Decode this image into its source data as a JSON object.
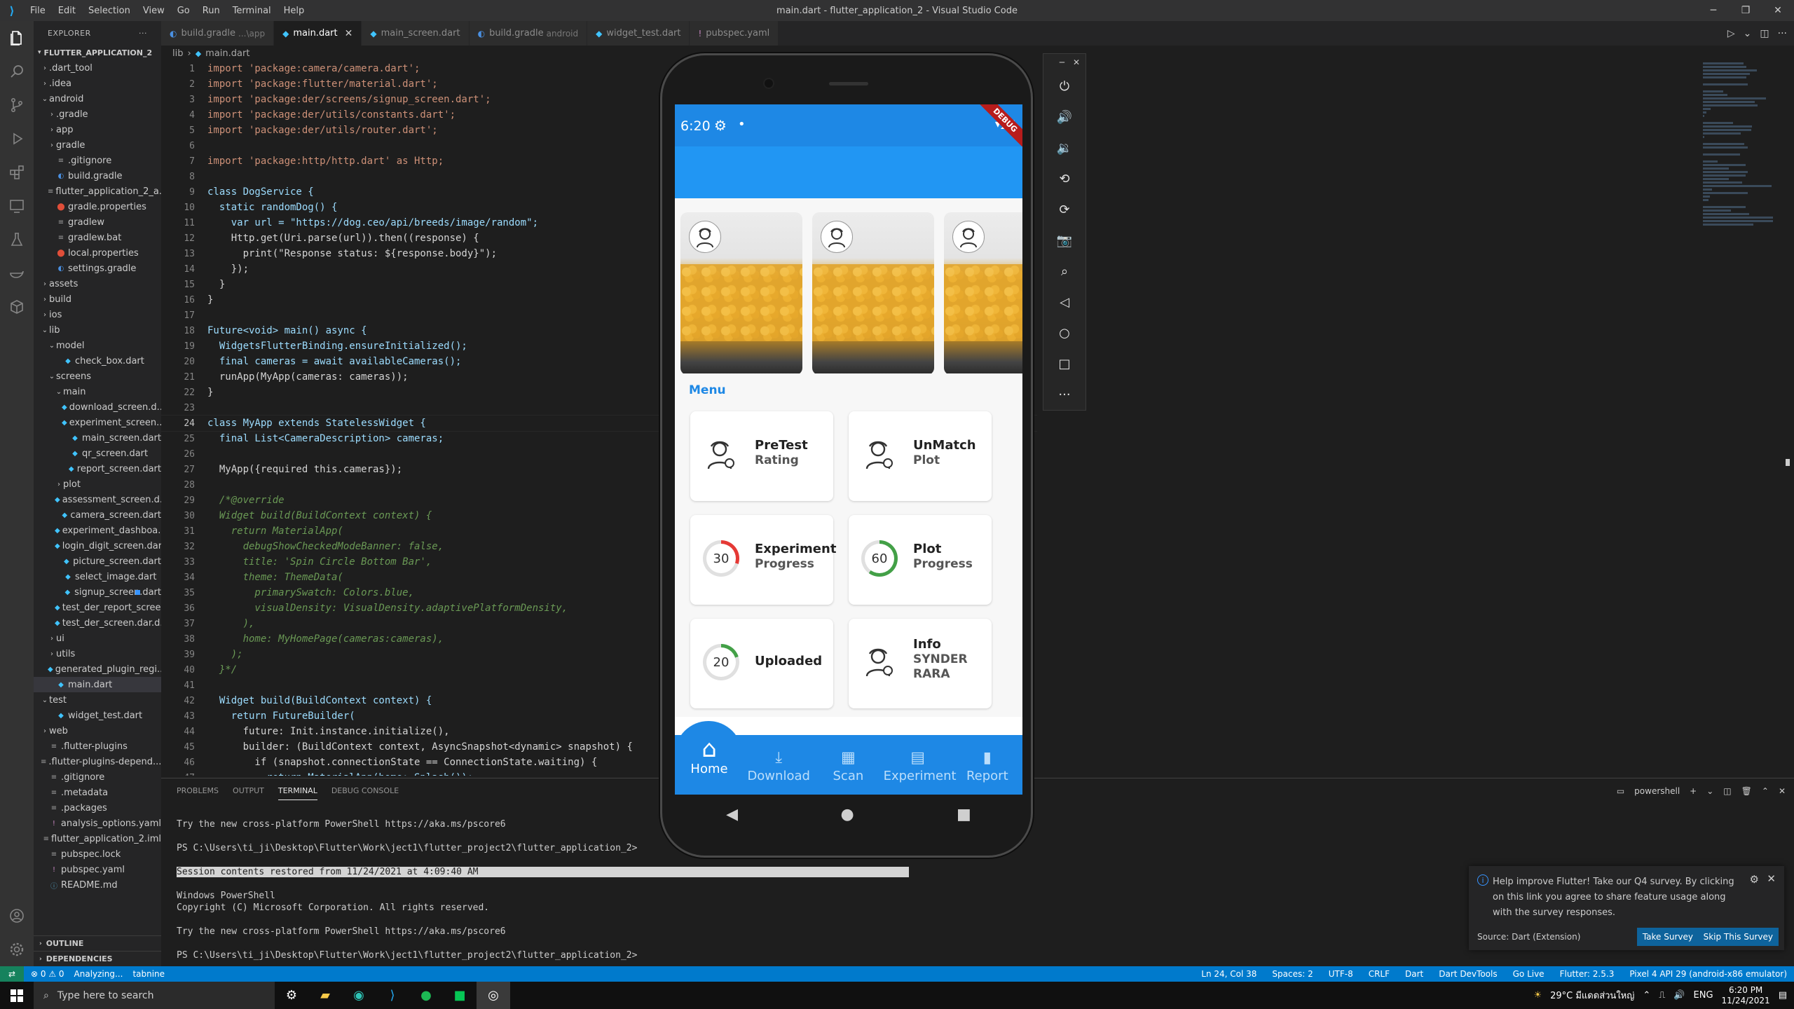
{
  "window_title": "main.dart - flutter_application_2 - Visual Studio Code",
  "menu": [
    "File",
    "Edit",
    "Selection",
    "View",
    "Go",
    "Run",
    "Terminal",
    "Help"
  ],
  "explorer": {
    "title": "EXPLORER",
    "project": "FLUTTER_APPLICATION_2",
    "items": [
      {
        "label": ".dart_tool",
        "depth": 1,
        "type": "folder",
        "open": false
      },
      {
        "label": ".idea",
        "depth": 1,
        "type": "folder",
        "open": false
      },
      {
        "label": "android",
        "depth": 1,
        "type": "folder",
        "open": true
      },
      {
        "label": ".gradle",
        "depth": 2,
        "type": "folder",
        "open": false
      },
      {
        "label": "app",
        "depth": 2,
        "type": "folder",
        "open": false
      },
      {
        "label": "gradle",
        "depth": 2,
        "type": "folder",
        "open": false
      },
      {
        "label": ".gitignore",
        "depth": 2,
        "type": "file"
      },
      {
        "label": "build.gradle",
        "depth": 2,
        "type": "gradle"
      },
      {
        "label": "flutter_application_2_a...",
        "depth": 2,
        "type": "file"
      },
      {
        "label": "gradle.properties",
        "depth": 2,
        "type": "props"
      },
      {
        "label": "gradlew",
        "depth": 2,
        "type": "file"
      },
      {
        "label": "gradlew.bat",
        "depth": 2,
        "type": "file"
      },
      {
        "label": "local.properties",
        "depth": 2,
        "type": "props"
      },
      {
        "label": "settings.gradle",
        "depth": 2,
        "type": "gradle"
      },
      {
        "label": "assets",
        "depth": 1,
        "type": "folder",
        "open": false
      },
      {
        "label": "build",
        "depth": 1,
        "type": "folder",
        "open": false
      },
      {
        "label": "ios",
        "depth": 1,
        "type": "folder",
        "open": false
      },
      {
        "label": "lib",
        "depth": 1,
        "type": "folder",
        "open": true
      },
      {
        "label": "model",
        "depth": 2,
        "type": "folder",
        "open": true
      },
      {
        "label": "check_box.dart",
        "depth": 3,
        "type": "dart"
      },
      {
        "label": "screens",
        "depth": 2,
        "type": "folder",
        "open": true
      },
      {
        "label": "main",
        "depth": 3,
        "type": "folder",
        "open": true
      },
      {
        "label": "download_screen.d...",
        "depth": 4,
        "type": "dart"
      },
      {
        "label": "experiment_screen....",
        "depth": 4,
        "type": "dart"
      },
      {
        "label": "main_screen.dart",
        "depth": 4,
        "type": "dart"
      },
      {
        "label": "qr_screen.dart",
        "depth": 4,
        "type": "dart"
      },
      {
        "label": "report_screen.dart",
        "depth": 4,
        "type": "dart"
      },
      {
        "label": "plot",
        "depth": 3,
        "type": "folder",
        "open": false
      },
      {
        "label": "assessment_screen.d...",
        "depth": 3,
        "type": "dart"
      },
      {
        "label": "camera_screen.dart",
        "depth": 3,
        "type": "dart"
      },
      {
        "label": "experiment_dashboa...",
        "depth": 3,
        "type": "dart"
      },
      {
        "label": "login_digit_screen.dart",
        "depth": 3,
        "type": "dart"
      },
      {
        "label": "picture_screen.dart",
        "depth": 3,
        "type": "dart"
      },
      {
        "label": "select_image.dart",
        "depth": 3,
        "type": "dart"
      },
      {
        "label": "signup_screen.dart",
        "depth": 3,
        "type": "dart"
      },
      {
        "label": "test_der_report_scree...",
        "depth": 3,
        "type": "dart"
      },
      {
        "label": "test_der_screen.dar.d...",
        "depth": 3,
        "type": "dart"
      },
      {
        "label": "ui",
        "depth": 2,
        "type": "folder",
        "open": false
      },
      {
        "label": "utils",
        "depth": 2,
        "type": "folder",
        "open": false
      },
      {
        "label": "generated_plugin_regi...",
        "depth": 2,
        "type": "dart"
      },
      {
        "label": "main.dart",
        "depth": 2,
        "type": "dart",
        "active": true
      },
      {
        "label": "test",
        "depth": 1,
        "type": "folder",
        "open": true
      },
      {
        "label": "widget_test.dart",
        "depth": 2,
        "type": "dart"
      },
      {
        "label": "web",
        "depth": 1,
        "type": "folder",
        "open": false
      },
      {
        "label": ".flutter-plugins",
        "depth": 1,
        "type": "file"
      },
      {
        "label": ".flutter-plugins-depend...",
        "depth": 1,
        "type": "file"
      },
      {
        "label": ".gitignore",
        "depth": 1,
        "type": "file"
      },
      {
        "label": ".metadata",
        "depth": 1,
        "type": "file"
      },
      {
        "label": ".packages",
        "depth": 1,
        "type": "file"
      },
      {
        "label": "analysis_options.yaml",
        "depth": 1,
        "type": "yaml"
      },
      {
        "label": "flutter_application_2.iml",
        "depth": 1,
        "type": "file"
      },
      {
        "label": "pubspec.lock",
        "depth": 1,
        "type": "file"
      },
      {
        "label": "pubspec.yaml",
        "depth": 1,
        "type": "yaml"
      },
      {
        "label": "README.md",
        "depth": 1,
        "type": "md"
      }
    ],
    "outline": "OUTLINE",
    "dependencies": "DEPENDENCIES"
  },
  "tabs": [
    {
      "label": "build.gradle",
      "sub": "...\\app",
      "icon": "gradle"
    },
    {
      "label": "main.dart",
      "sub": "",
      "icon": "dart",
      "active": true
    },
    {
      "label": "main_screen.dart",
      "sub": "",
      "icon": "dart"
    },
    {
      "label": "build.gradle",
      "sub": "android",
      "icon": "gradle"
    },
    {
      "label": "widget_test.dart",
      "sub": "",
      "icon": "dart"
    },
    {
      "label": "pubspec.yaml",
      "sub": "",
      "icon": "yaml"
    }
  ],
  "breadcrumb": [
    "lib",
    "main.dart"
  ],
  "code": [
    "import 'package:camera/camera.dart';",
    "import 'package:flutter/material.dart';",
    "import 'package:der/screens/signup_screen.dart';",
    "import 'package:der/utils/constants.dart';",
    "import 'package:der/utils/router.dart';",
    "",
    "import 'package:http/http.dart' as Http;",
    "",
    "class DogService {",
    "  static randomDog() {",
    "    var url = \"https://dog.ceo/api/breeds/image/random\";",
    "    Http.get(Uri.parse(url)).then((response) {",
    "      print(\"Response status: ${response.body}\");",
    "    });",
    "  }",
    "}",
    "",
    "Future<void> main() async {",
    "  WidgetsFlutterBinding.ensureInitialized();",
    "  final cameras = await availableCameras();",
    "  runApp(MyApp(cameras: cameras));",
    "}",
    "",
    "class MyApp extends StatelessWidget {",
    "  final List<CameraDescription> cameras;",
    "",
    "  MyApp({required this.cameras});",
    "",
    "  /*@override",
    "  Widget build(BuildContext context) {",
    "    return MaterialApp(",
    "      debugShowCheckedModeBanner: false,",
    "      title: 'Spin Circle Bottom Bar',",
    "      theme: ThemeData(",
    "        primarySwatch: Colors.blue,",
    "        visualDensity: VisualDensity.adaptivePlatformDensity,",
    "      ),",
    "      home: MyHomePage(cameras:cameras),",
    "    );",
    "  }*/",
    "",
    "  Widget build(BuildContext context) {",
    "    return FutureBuilder(",
    "      future: Init.instance.initialize(),",
    "      builder: (BuildContext context, AsyncSnapshot<dynamic> snapshot) {",
    "        if (snapshot.connectionState == ConnectionState.waiting) {",
    "          return MaterialApp(home: Splash());"
  ],
  "current_line": 24,
  "panel": {
    "tabs": [
      "PROBLEMS",
      "OUTPUT",
      "TERMINAL",
      "DEBUG CONSOLE"
    ],
    "active_tab": "TERMINAL",
    "shell": "powershell",
    "terminal_lines": [
      "Try the new cross-platform PowerShell https://aka.ms/pscore6",
      "",
      "PS C:\\Users\\ti_ji\\Desktop\\Flutter\\Work\\ject1\\flutter_project2\\flutter_application_2>",
      "",
      "Session contents restored from 11/24/2021 at 4:09:40 AM",
      "",
      "Windows PowerShell",
      "Copyright (C) Microsoft Corporation. All rights reserved.",
      "",
      "Try the new cross-platform PowerShell https://aka.ms/pscore6",
      "",
      "PS C:\\Users\\ti_ji\\Desktop\\Flutter\\Work\\ject1\\flutter_project2\\flutter_application_2>"
    ]
  },
  "notification": {
    "text": "Help improve Flutter! Take our Q4 survey. By clicking on this link you agree to share feature usage along with the survey responses.",
    "source": "Source: Dart (Extension)",
    "take": "Take Survey",
    "skip": "Skip This Survey"
  },
  "statusbar": {
    "left": [
      "⊗ 0 ⚠ 0",
      "Analyzing...",
      "tabnine"
    ],
    "right": [
      "Ln 24, Col 38",
      "Spaces: 2",
      "UTF-8",
      "CRLF",
      "Dart",
      "Dart DevTools",
      "Go Live",
      "Flutter: 2.5.3",
      "Pixel 4 API 29 (android-x86 emulator)"
    ]
  },
  "taskbar": {
    "search_placeholder": "Type here to search",
    "weather": "29°C มีแดดส่วนใหญ่",
    "lang": "ENG",
    "time": "6:20 PM",
    "date": "11/24/2021"
  },
  "phone": {
    "time": "6:20",
    "debug": "DEBUG",
    "menu_title": "Menu",
    "cards": [
      {
        "title": "PreTest",
        "subtitle": "Rating",
        "kind": "icon"
      },
      {
        "title": "UnMatch",
        "subtitle": "Plot",
        "kind": "icon"
      },
      {
        "title": "Experiment",
        "subtitle": "Progress",
        "kind": "ring",
        "value": "30",
        "progress": 0.3,
        "color": "#e53935"
      },
      {
        "title": "Plot",
        "subtitle": "Progress",
        "kind": "ring",
        "value": "60",
        "progress": 0.6,
        "color": "#43a047"
      },
      {
        "title": "Uploaded",
        "subtitle": "",
        "kind": "ring",
        "value": "20",
        "progress": 0.2,
        "color": "#43a047"
      },
      {
        "title": "Info",
        "subtitle": "SYNDER\nRARA",
        "kind": "icon"
      }
    ],
    "nav": [
      {
        "label": "Home",
        "icon": "home-icon",
        "active": true
      },
      {
        "label": "Download",
        "icon": "download-icon"
      },
      {
        "label": "Scan",
        "icon": "qr-icon"
      },
      {
        "label": "Experiment",
        "icon": "experiment-icon"
      },
      {
        "label": "Report",
        "icon": "report-icon"
      }
    ]
  },
  "colors": {
    "accent": "#007acc",
    "app_blue": "#1e88e5"
  }
}
